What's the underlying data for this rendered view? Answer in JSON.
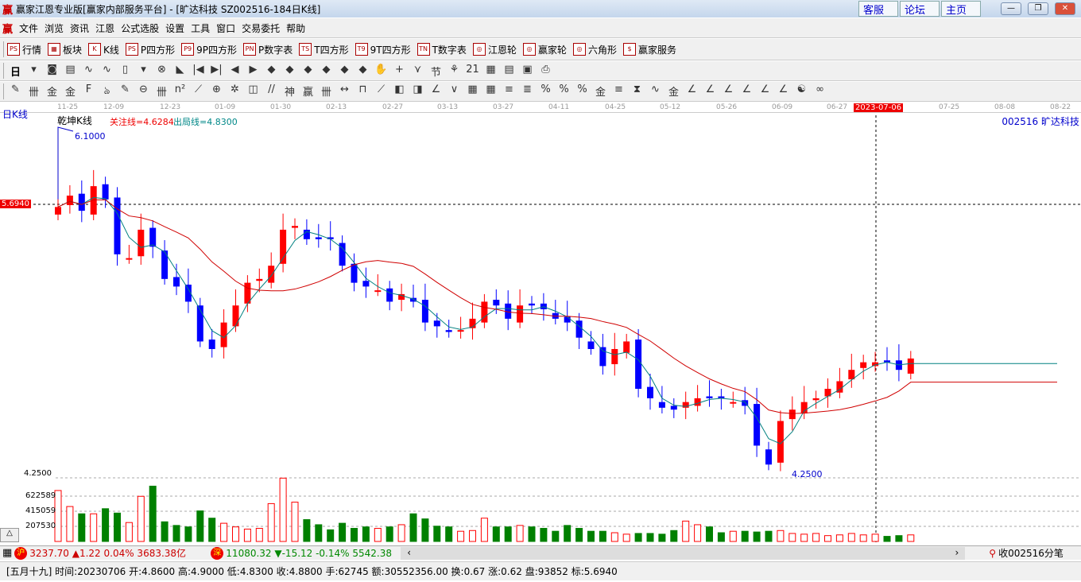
{
  "window": {
    "logo": "赢",
    "title": "赢家江恩专业版[赢家内部服务平台] - [旷达科技  SZ002516-184日K线]",
    "links": [
      "客服",
      "论坛",
      "主页"
    ],
    "controls": [
      "—",
      "❐",
      "✕"
    ]
  },
  "menu": {
    "logo": "赢",
    "items": [
      "文件",
      "浏览",
      "资讯",
      "江恩",
      "公式选股",
      "设置",
      "工具",
      "窗口",
      "交易委托",
      "帮助"
    ],
    "mdi": [
      "_",
      "❐",
      "X"
    ]
  },
  "toolbar1": [
    {
      "icon": "PS",
      "label": "行情"
    },
    {
      "icon": "▦",
      "label": "板块"
    },
    {
      "icon": "K",
      "label": "K线"
    },
    {
      "icon": "PS",
      "label": "P四方形"
    },
    {
      "icon": "P9",
      "label": "9P四方形"
    },
    {
      "icon": "PN",
      "label": "P数字表"
    },
    {
      "icon": "TS",
      "label": "T四方形"
    },
    {
      "icon": "T9",
      "label": "9T四方形"
    },
    {
      "icon": "TN",
      "label": "T数字表"
    },
    {
      "icon": "◎",
      "label": "江恩轮"
    },
    {
      "icon": "◎",
      "label": "赢家轮"
    },
    {
      "icon": "◎",
      "label": "六角形"
    },
    {
      "icon": "$",
      "label": "赢家服务"
    }
  ],
  "toolbar2": {
    "period": "日",
    "icons": [
      "▾",
      "◙",
      "▤",
      "∿",
      "∿",
      "▯",
      "▾",
      "⊗",
      "◣",
      "|◀",
      "▶|",
      "◀",
      "▶",
      "◆",
      "◆",
      "◆",
      "◆",
      "◆",
      "◆",
      "✋",
      "+",
      "⋎",
      "节",
      "⚘",
      "21",
      "▦",
      "▤",
      "▣",
      "⎙"
    ]
  },
  "toolbar3": {
    "icons": [
      "✎",
      "卌",
      "金",
      "金",
      "F",
      "ঌ",
      "✎",
      "⊖",
      "卌",
      "n²",
      "⟋",
      "⊕",
      "✲",
      "◫",
      "//",
      "神",
      "赢",
      "卌",
      "↔",
      "⊓",
      "⟋",
      "◧",
      "◨",
      "∠",
      "∨",
      "▦",
      "▦",
      "≡",
      "≣",
      "%",
      "%",
      "%",
      "金",
      "≡",
      "⧗",
      "∿",
      "金",
      "∠",
      "∠",
      "∠",
      "∠",
      "∠",
      "∠",
      "☯",
      "∞"
    ]
  },
  "chart": {
    "period_label": "日K线",
    "indicator": "乾坤K线",
    "watch_line": "关注线=4.6284",
    "exit_line": "出局线=4.8300",
    "stock": "002516 旷达科技",
    "cursor_price": "5.6940",
    "high_label": "6.1000",
    "low_label": "4.2500",
    "low_axis": "4.2500",
    "dates": [
      "11-25",
      "12-09",
      "12-23",
      "01-09",
      "01-30",
      "02-13",
      "02-27",
      "03-13",
      "03-27",
      "04-11",
      "04-25",
      "05-12",
      "05-26",
      "06-09",
      "06-27",
      "2023-07-06",
      "07-25",
      "08-08",
      "08-22"
    ],
    "selected_date": "2023-07-06",
    "volume_ticks": [
      "622589",
      "415059",
      "207530"
    ],
    "colors": {
      "up": "#ff0000",
      "down": "#0000ff",
      "ma_short": "#008080",
      "ma_long": "#d00000",
      "vol_down": "#008000"
    }
  },
  "chart_data": {
    "type": "candlestick",
    "title": "旷达科技 SZ002516 日K线",
    "ylim": [
      4.25,
      6.1
    ],
    "close": [
      5.68,
      5.74,
      5.66,
      5.79,
      5.72,
      5.43,
      5.41,
      5.56,
      5.47,
      5.3,
      5.26,
      5.18,
      4.97,
      4.93,
      5.07,
      5.16,
      5.28,
      5.3,
      5.37,
      5.56,
      5.58,
      5.51,
      5.51,
      5.51,
      5.37,
      5.28,
      5.26,
      5.24,
      5.18,
      5.22,
      5.18,
      5.07,
      5.05,
      5.02,
      5.03,
      5.09,
      5.18,
      5.16,
      5.09,
      5.16,
      5.16,
      5.14,
      5.09,
      5.07,
      4.99,
      4.93,
      4.84,
      4.93,
      4.97,
      4.72,
      4.67,
      4.62,
      4.61,
      4.65,
      4.67,
      4.67,
      4.67,
      4.65,
      4.63,
      4.42,
      4.32,
      4.55,
      4.61,
      4.65,
      4.67,
      4.72,
      4.76,
      4.82,
      4.86,
      4.86,
      4.86,
      4.82,
      4.88
    ],
    "volume": [
      700000,
      480000,
      380000,
      380000,
      450000,
      390000,
      260000,
      620000,
      760000,
      270000,
      220000,
      200000,
      420000,
      320000,
      250000,
      200000,
      170000,
      180000,
      520000,
      870000,
      540000,
      300000,
      230000,
      160000,
      250000,
      180000,
      200000,
      180000,
      200000,
      230000,
      380000,
      310000,
      210000,
      200000,
      140000,
      150000,
      320000,
      200000,
      200000,
      220000,
      200000,
      180000,
      140000,
      220000,
      180000,
      140000,
      140000,
      120000,
      100000,
      110000,
      110000,
      100000,
      150000,
      280000,
      230000,
      200000,
      120000,
      140000,
      140000,
      130000,
      140000,
      150000,
      110000,
      100000,
      110000,
      80000,
      90000,
      110000,
      90000,
      100000,
      70000,
      80000,
      90000
    ]
  },
  "index_bar": {
    "sh_badge": "沪",
    "sh": "3237.70 ▲1.22 0.04% 3683.38亿",
    "sz_badge": "深",
    "sz": "11080.32 ▼-15.12 -0.14% 5542.38",
    "right": "收002516分笔"
  },
  "status": "[五月十九] 时间:20230706 开:4.8600 高:4.9000 低:4.8300 收:4.8800 手:62745 额:30552356.00 换:0.67 涨:0.62 盘:93852 标:5.6940"
}
